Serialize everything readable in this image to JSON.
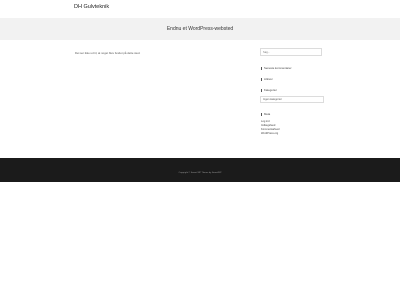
{
  "header": {
    "site_title": "DH Gulvteknik"
  },
  "banner": {
    "title": "Endnu et WordPress-websted"
  },
  "content": {
    "text": "Det ser ikke ud til, at noget blev fundet på dette sted."
  },
  "sidebar": {
    "search_placeholder": "Søg...",
    "recent_posts_title": "Seneste kommentarer",
    "archives_title": "Arkiver",
    "categories_title": "Kategorier",
    "categories_select": "Ingen kategorier",
    "meta_title": "Meta",
    "meta_links": [
      "Log ind",
      "Indlægsfeed",
      "Kommentarfeed",
      "WordPress.org"
    ]
  },
  "footer": {
    "text": "Copyright © Sweet WP Theme by SweetWP"
  },
  "colors": {
    "banner_bg": "#f2f2f2",
    "footer_bg": "#1b1b1b"
  }
}
